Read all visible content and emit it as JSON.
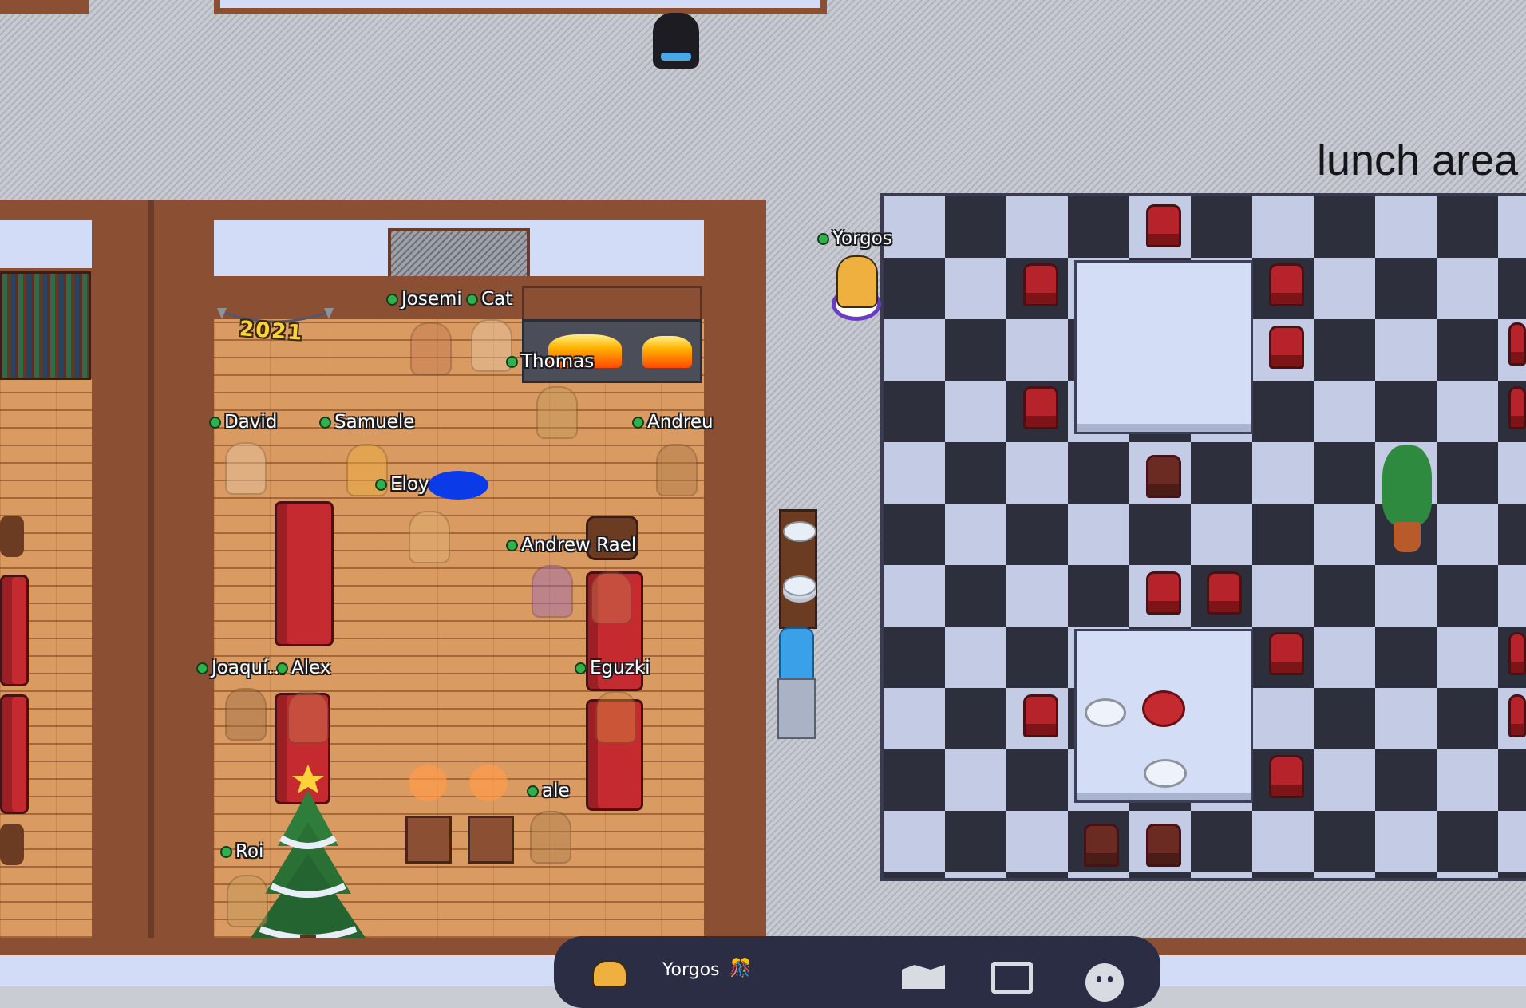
{
  "map": {
    "area_label": "lunch area",
    "banner_text": "2021",
    "players": [
      {
        "name": "Yorgos"
      },
      {
        "name": "Josemi"
      },
      {
        "name": "Cat"
      },
      {
        "name": "Thomas"
      },
      {
        "name": "David"
      },
      {
        "name": "Samuele"
      },
      {
        "name": "Andreu"
      },
      {
        "name": "Eloy"
      },
      {
        "name": "Andrew Rael"
      },
      {
        "name": "Joaquí..."
      },
      {
        "name": "Alex"
      },
      {
        "name": "Eguzki"
      },
      {
        "name": "ale"
      },
      {
        "name": "Roi"
      }
    ]
  },
  "dock": {
    "user_name": "Yorgos",
    "status_emoji": "🎊",
    "icons": [
      "avatar-icon",
      "map-icon",
      "screen-share-icon",
      "emoji-icon"
    ]
  },
  "colors": {
    "status_online": "#2fb24b",
    "wood_wall": "#8b4f34",
    "checker_dark": "#2d2f3c",
    "checker_light": "#c3cce4",
    "chair_red": "#b7232a"
  }
}
